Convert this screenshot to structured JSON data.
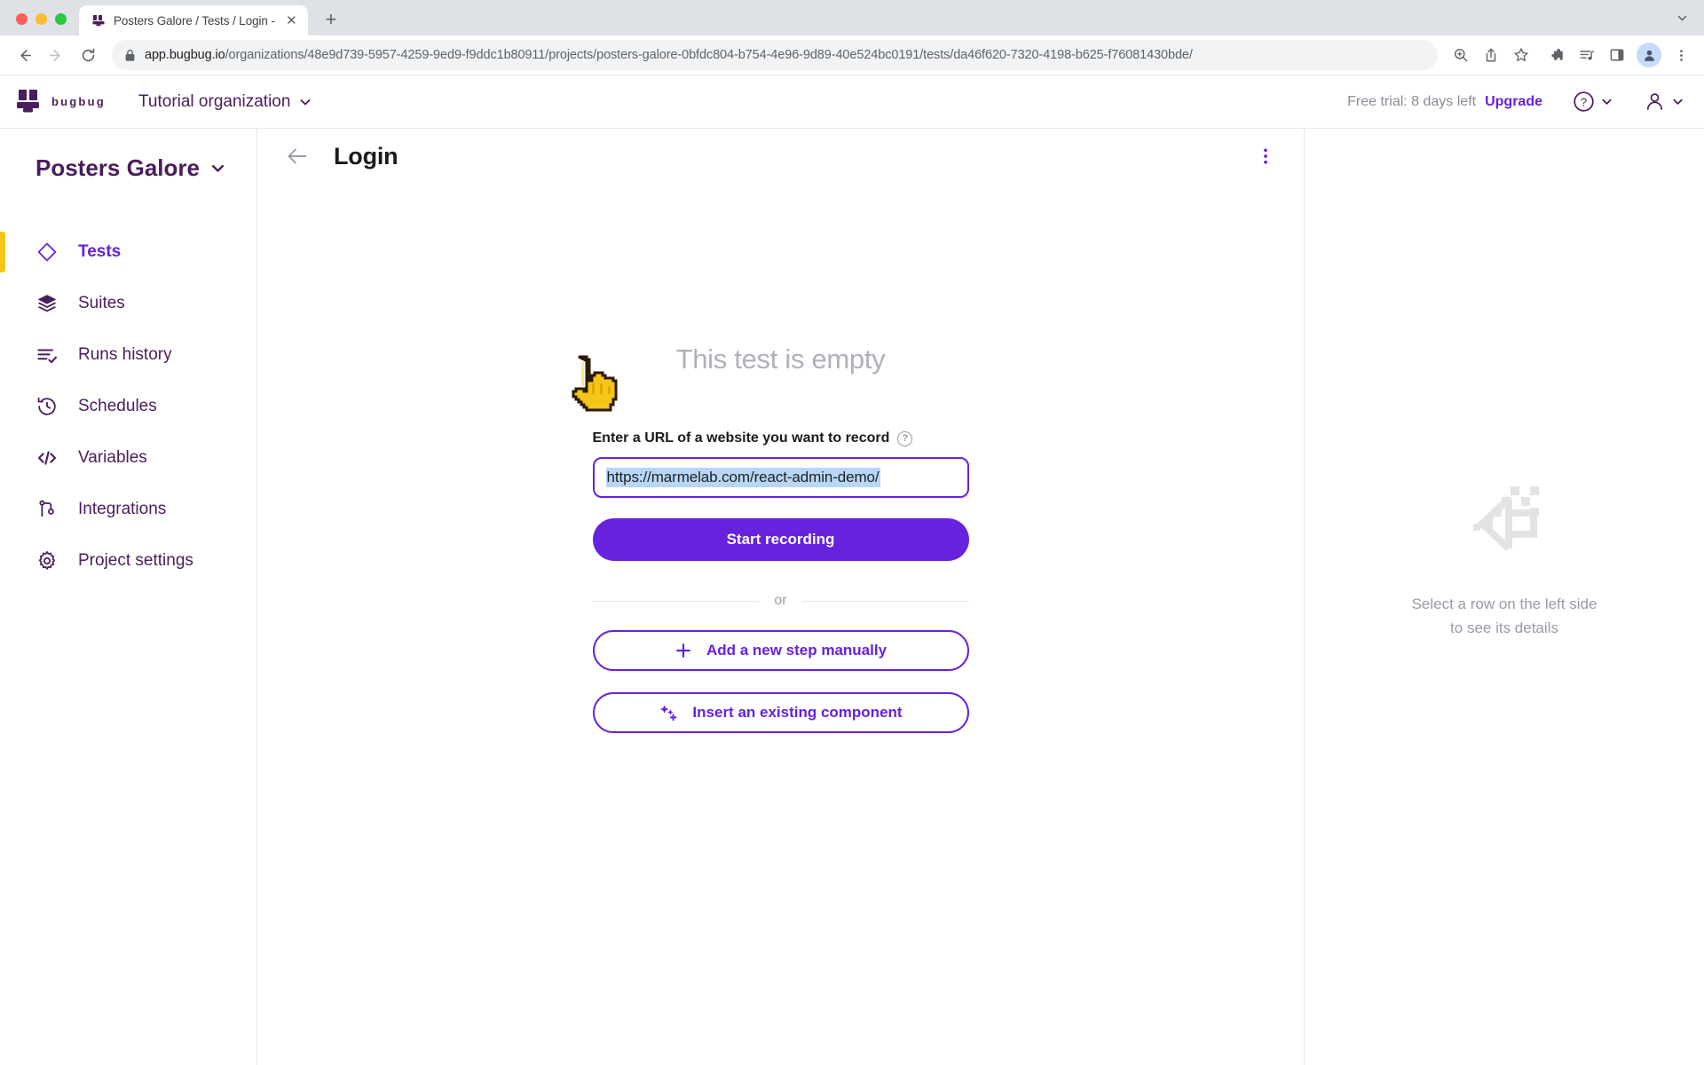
{
  "browser": {
    "tab": {
      "title": "Posters Galore / Tests / Login -",
      "favicon_name": "bugbug-favicon",
      "close_label": "✕"
    },
    "new_tab_label": "+",
    "traffic_lights": [
      "close",
      "minimize",
      "maximize"
    ],
    "nav": {
      "back": "←",
      "forward": "→",
      "reload": "⟳"
    },
    "omnibox": {
      "host": "app.bugbug.io",
      "path": "/organizations/48e9d739-5957-4259-9ed9-f9ddc1b80911/projects/posters-galore-0bfdc804-b754-4e96-9d89-40e524bc0191/tests/da46f620-7320-4198-b625-f76081430bde/",
      "lock_icon": "lock-icon"
    },
    "toolbar_icons": [
      "zoom-in-icon",
      "share-icon",
      "bookmark-star-icon",
      "extensions-icon",
      "media-list-icon",
      "side-panel-icon",
      "profile-avatar-icon",
      "browser-menu-icon"
    ]
  },
  "app_header": {
    "logo_word": "bugbug",
    "organization": "Tutorial organization",
    "trial_text": "Free trial: 8 days left",
    "upgrade_label": "Upgrade",
    "help_icon": "help-circle-icon",
    "account_icon": "user-icon"
  },
  "sidebar": {
    "project_name": "Posters Galore",
    "items": [
      {
        "label": "Tests",
        "icon": "diamond-icon",
        "active": true
      },
      {
        "label": "Suites",
        "icon": "layers-icon",
        "active": false
      },
      {
        "label": "Runs history",
        "icon": "runs-icon",
        "active": false
      },
      {
        "label": "Schedules",
        "icon": "clock-back-icon",
        "active": false
      },
      {
        "label": "Variables",
        "icon": "code-icon",
        "active": false
      },
      {
        "label": "Integrations",
        "icon": "sitemap-icon",
        "active": false
      },
      {
        "label": "Project settings",
        "icon": "gear-icon",
        "active": false
      }
    ]
  },
  "main": {
    "back_label": "←",
    "title": "Login",
    "kebab_label": "⋮",
    "empty_title": "This test is empty",
    "url_label": "Enter a URL of a website you want to record",
    "url_help": "?",
    "url_value": "https://marmelab.com/react-admin-demo/",
    "url_placeholder": "https://",
    "start_recording_label": "Start recording",
    "or_label": "or",
    "add_step_label": "Add a new step manually",
    "add_step_icon": "plus-icon",
    "insert_component_label": "Insert an existing component",
    "insert_component_icon": "sparkle-plus-icon",
    "cursor_icon": "pointing-hand-cursor"
  },
  "details_pane": {
    "empty_icon": "left-arrow-pixel-icon",
    "empty_text": "Select a row on the left side\nto see its details"
  },
  "colors": {
    "brand_purple": "#6622dd",
    "deep_purple": "#4a1d5c",
    "accent_yellow": "#f5c518",
    "muted_gray": "#9a9aa5",
    "selection_blue": "#b6d7f7"
  }
}
